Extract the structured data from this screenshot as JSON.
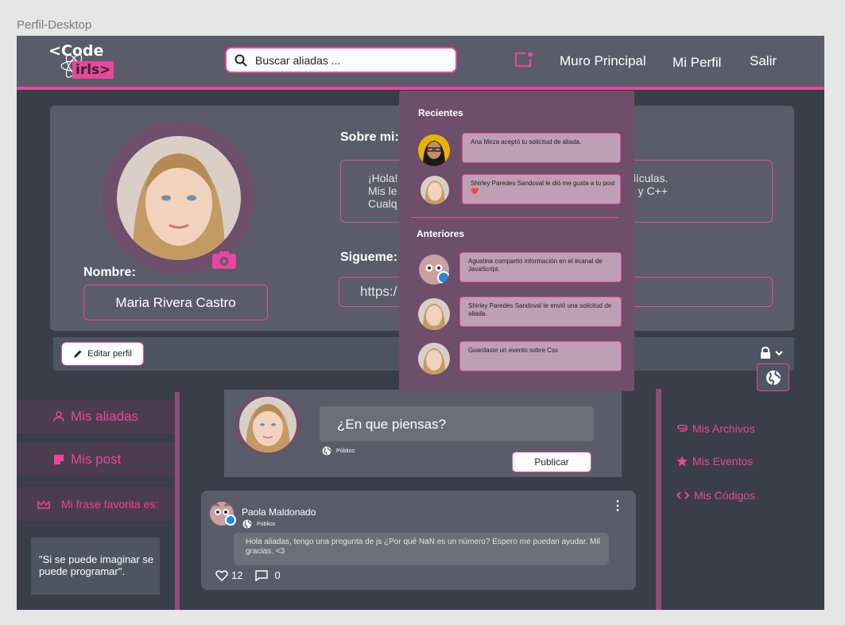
{
  "frame_label": "Perfil-Desktop",
  "header": {
    "logo_top": "<Code",
    "logo_bottom": "irls>",
    "search_placeholder": "Buscar aliadas ...",
    "nav": [
      "Muro Principal",
      "Mi Perfil",
      "Salir"
    ]
  },
  "profile": {
    "name_label": "Nombre:",
    "name": "Maria Rivera Castro",
    "about_label": "Sobre mi:",
    "about_lines": [
      "¡Hola!",
      "Mis le",
      "Cualq"
    ],
    "about_lines_right": [
      "elículas.",
      "p  y C++"
    ],
    "follow_label": "Sigueme:",
    "link": "https:/"
  },
  "edit_bar": {
    "edit_label": "Editar perfil"
  },
  "left_sidebar": {
    "items": [
      "Mis aliadas",
      "Mis post",
      "Mi frase favorita es:"
    ],
    "quote": "\"Si se puede  imaginar se puede programar\"."
  },
  "composer": {
    "prompt": "¿En que piensas?",
    "privacy": "Público",
    "publish": "Publicar"
  },
  "post": {
    "author": "Paola Maldonado",
    "privacy": "Público",
    "text": "Hola aliadas, tengo una pregunta de js ¿Por qué NaN es un número? Espero me puedan ayudar. Mil gracias. <3",
    "likes": "12",
    "comments": "0"
  },
  "right_sidebar": {
    "items": [
      "Mis Archivos",
      "Mis Eventos",
      "Mis Códigos"
    ]
  },
  "notifications": {
    "recent_label": "Recientes",
    "older_label": "Anteriores",
    "recent": [
      "Ana Meza aceptó tu solicitud de aliada.",
      "Shirley Paredes Sandoval  le dió me gusta a tu post ❤️"
    ],
    "older": [
      "Agustina compartió información en el  #canal de JavaScript.",
      "Shirley Paredes Sandoval te envió una solicitud de aliada.",
      "Guardaste un evento sobre Css"
    ]
  },
  "colors": {
    "accent": "#e8479b",
    "header_bg": "#5b5c69",
    "frame_bg": "#3a3e49",
    "dropdown_bg": "#6d4f6b"
  }
}
